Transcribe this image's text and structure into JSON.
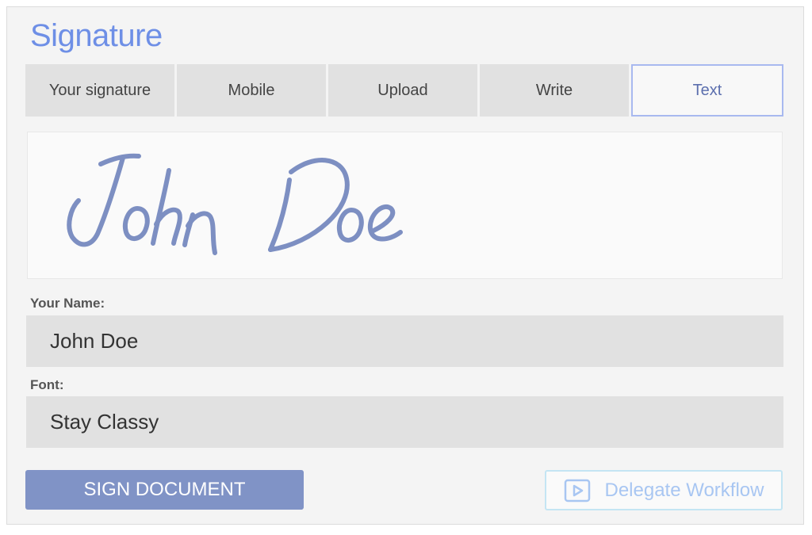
{
  "header": {
    "title": "Signature"
  },
  "tabs": [
    {
      "label": "Your signature",
      "active": false
    },
    {
      "label": "Mobile",
      "active": false
    },
    {
      "label": "Upload",
      "active": false
    },
    {
      "label": "Write",
      "active": false
    },
    {
      "label": "Text",
      "active": true
    }
  ],
  "preview": {
    "signature_text": "John Doe"
  },
  "form": {
    "name_label": "Your Name:",
    "name_value": "John Doe",
    "font_label": "Font:",
    "font_value": "Stay Classy"
  },
  "actions": {
    "sign_label": "SIGN DOCUMENT",
    "delegate_label": "Delegate Workflow",
    "delegate_icon": "play-icon"
  },
  "colors": {
    "accent": "#6e8fe6",
    "signature_ink": "#7d8fc2",
    "sign_button": "#8093c6",
    "delegate_text": "#a8c6f2"
  }
}
